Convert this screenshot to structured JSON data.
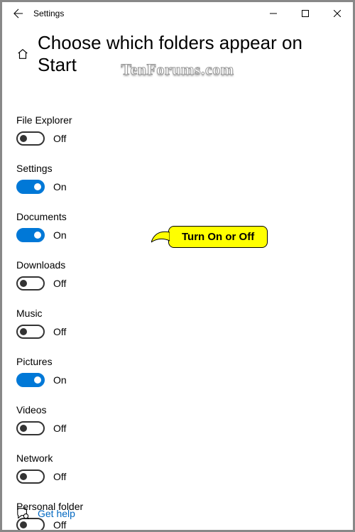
{
  "window": {
    "title": "Settings"
  },
  "page": {
    "heading": "Choose which folders appear on Start"
  },
  "watermark": "TenForums.com",
  "callout": {
    "text": "Turn On or Off"
  },
  "state_labels": {
    "on": "On",
    "off": "Off"
  },
  "settings": [
    {
      "label": "File Explorer",
      "on": false
    },
    {
      "label": "Settings",
      "on": true
    },
    {
      "label": "Documents",
      "on": true
    },
    {
      "label": "Downloads",
      "on": false
    },
    {
      "label": "Music",
      "on": false
    },
    {
      "label": "Pictures",
      "on": true
    },
    {
      "label": "Videos",
      "on": false
    },
    {
      "label": "Network",
      "on": false
    },
    {
      "label": "Personal folder",
      "on": false
    }
  ],
  "help": {
    "label": "Get help"
  }
}
